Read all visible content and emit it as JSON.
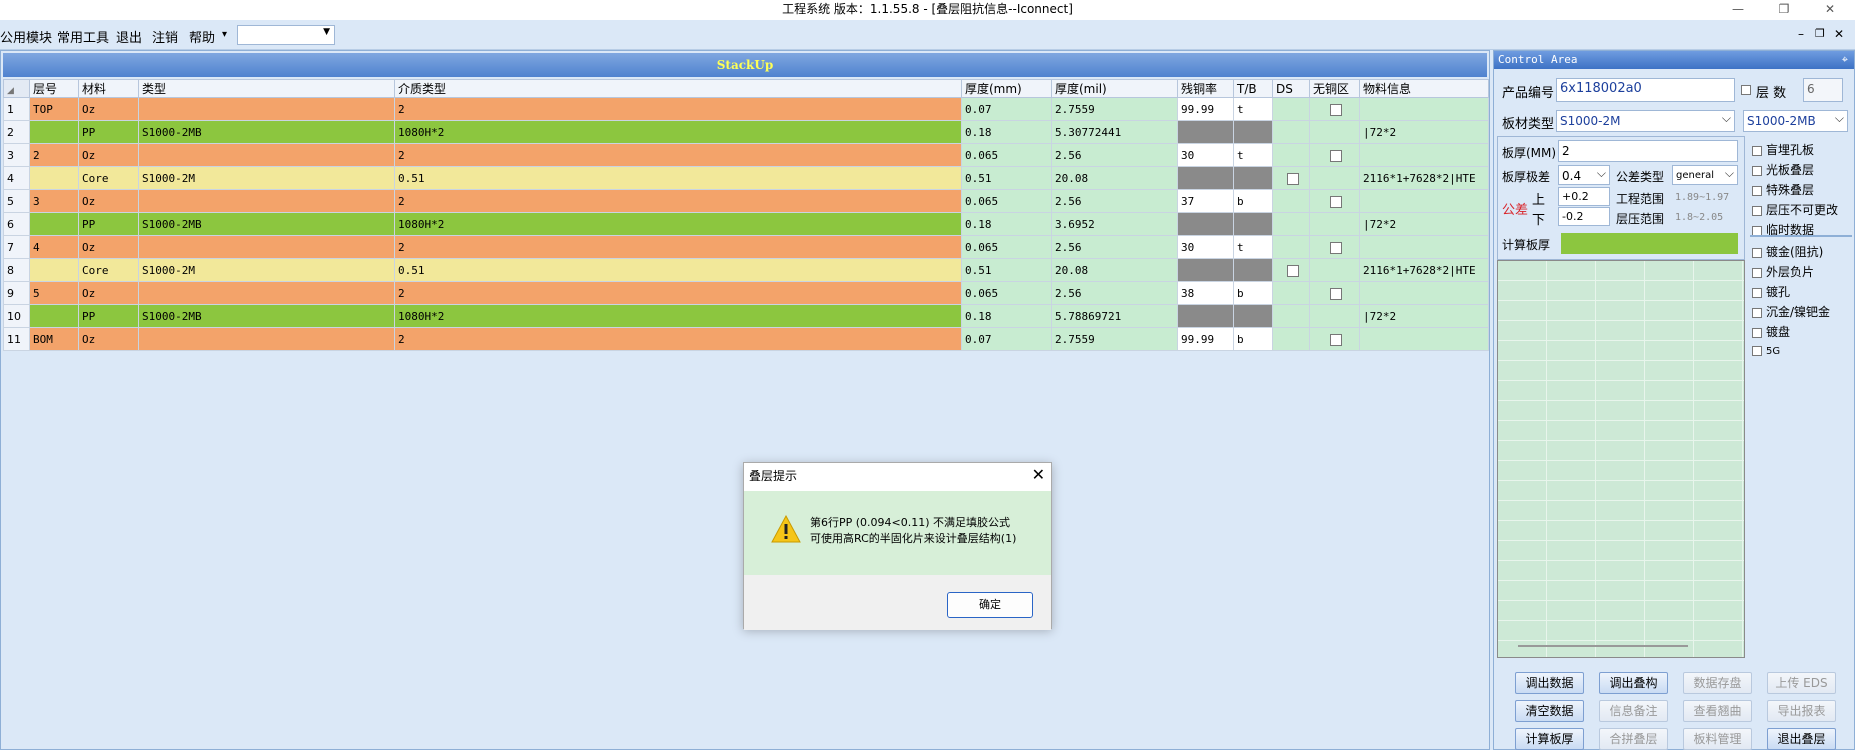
{
  "window": {
    "title": "工程系统   版本：1.1.55.8 - [叠层阻抗信息--Iconnect]",
    "minimize": "—",
    "restore": "❐",
    "close": "✕"
  },
  "menu": {
    "items": [
      "公用模块",
      "常用工具",
      "退出",
      "注销",
      "帮助"
    ],
    "help_arrow": "▾",
    "combo_value": "",
    "mdi_controls": [
      "–",
      "❐",
      "✕"
    ]
  },
  "stackup": {
    "title": "StackUp",
    "columns": [
      "层号",
      "材料",
      "类型",
      "介质类型",
      "厚度(mm)",
      "厚度(mil)",
      "残铜率",
      "T/B",
      "DS",
      "无铜区",
      "物料信息"
    ],
    "rows": [
      {
        "num": "1",
        "layer": "TOP",
        "material": "Oz",
        "type": "",
        "dielectric": "2",
        "mm": "0.07",
        "mil": "2.7559",
        "cu": "99.99",
        "tb": "t",
        "info": "",
        "kind": "copper"
      },
      {
        "num": "2",
        "layer": "",
        "material": "PP",
        "type": "S1000-2MB",
        "dielectric": "1080H*2",
        "mm": "0.18",
        "mil": "5.30772441",
        "cu": "",
        "tb": "",
        "info": "|72*2",
        "kind": "pp"
      },
      {
        "num": "3",
        "layer": "2",
        "material": "Oz",
        "type": "",
        "dielectric": "2",
        "mm": "0.065",
        "mil": "2.56",
        "cu": "30",
        "tb": "t",
        "info": "",
        "kind": "copper"
      },
      {
        "num": "4",
        "layer": "",
        "material": "Core",
        "type": "S1000-2M",
        "dielectric": "0.51",
        "mm": "0.51",
        "mil": "20.08",
        "cu": "",
        "tb": "",
        "info": "2116*1+7628*2|HTE",
        "kind": "core"
      },
      {
        "num": "5",
        "layer": "3",
        "material": "Oz",
        "type": "",
        "dielectric": "2",
        "mm": "0.065",
        "mil": "2.56",
        "cu": "37",
        "tb": "b",
        "info": "",
        "kind": "copper"
      },
      {
        "num": "6",
        "layer": "",
        "material": "PP",
        "type": "S1000-2MB",
        "dielectric": "1080H*2",
        "mm": "0.18",
        "mil": "3.6952",
        "cu": "",
        "tb": "",
        "info": "|72*2",
        "kind": "pp"
      },
      {
        "num": "7",
        "layer": "4",
        "material": "Oz",
        "type": "",
        "dielectric": "2",
        "mm": "0.065",
        "mil": "2.56",
        "cu": "30",
        "tb": "t",
        "info": "",
        "kind": "copper"
      },
      {
        "num": "8",
        "layer": "",
        "material": "Core",
        "type": "S1000-2M",
        "dielectric": "0.51",
        "mm": "0.51",
        "mil": "20.08",
        "cu": "",
        "tb": "",
        "info": "2116*1+7628*2|HTE",
        "kind": "core"
      },
      {
        "num": "9",
        "layer": "5",
        "material": "Oz",
        "type": "",
        "dielectric": "2",
        "mm": "0.065",
        "mil": "2.56",
        "cu": "38",
        "tb": "b",
        "info": "",
        "kind": "copper"
      },
      {
        "num": "10",
        "layer": "",
        "material": "PP",
        "type": "S1000-2MB",
        "dielectric": "1080H*2",
        "mm": "0.18",
        "mil": "5.78869721",
        "cu": "",
        "tb": "",
        "info": "|72*2",
        "kind": "pp"
      },
      {
        "num": "11",
        "layer": "BOM",
        "material": "Oz",
        "type": "",
        "dielectric": "2",
        "mm": "0.07",
        "mil": "2.7559",
        "cu": "99.99",
        "tb": "b",
        "info": "",
        "kind": "copper"
      }
    ]
  },
  "dialog": {
    "title": "叠层提示",
    "line1": "第6行PP (0.094<0.11) 不满足填胶公式",
    "line2": "可使用高RC的半固化片来设计叠层结构(1)",
    "ok": "确定",
    "close": "✕"
  },
  "control": {
    "title": "Control Area",
    "pin": "⌖",
    "product_label": "产品编号",
    "product_value": "6x118002a0",
    "layers_label": "层 数",
    "layers_value": "6",
    "board_type_label": "板材类型",
    "board_type_value": "S1000-2M",
    "board_type_value2": "S1000-2MB",
    "thickness_label": "板厚(MM)",
    "thickness_value": "2",
    "tol_label": "板厚极差",
    "tol_value": "0.4",
    "tol_type_label": "公差类型",
    "tol_type_value": "general",
    "gongcha_label": "公差",
    "upper_label": "上",
    "lower_label": "下",
    "upper_value": "+0.2",
    "lower_value": "-0.2",
    "eng_range_label": "工程范围",
    "eng_range_value": "1.89~1.97",
    "press_range_label": "层压范围",
    "press_range_value": "1.8~2.05",
    "calc_label": "计算板厚",
    "options": [
      "盲埋孔板",
      "光板叠层",
      "特殊叠层",
      "层压不可更改",
      "临时数据",
      "镀金(阻抗)",
      "外层负片",
      "镀孔",
      "沉金/镍钯金",
      "镀盘",
      "5G"
    ],
    "buttons": [
      {
        "label": "调出数据",
        "enabled": true
      },
      {
        "label": "调出叠构",
        "enabled": true
      },
      {
        "label": "数据存盘",
        "enabled": false
      },
      {
        "label": "上传 EDS",
        "enabled": false
      },
      {
        "label": "清空数据",
        "enabled": true
      },
      {
        "label": "信息备注",
        "enabled": false
      },
      {
        "label": "查看翘曲",
        "enabled": false
      },
      {
        "label": "导出报表",
        "enabled": false
      },
      {
        "label": "计算板厚",
        "enabled": true
      },
      {
        "label": "合拼叠层",
        "enabled": false
      },
      {
        "label": "板料管理",
        "enabled": false
      },
      {
        "label": "退出叠层",
        "enabled": true
      }
    ]
  },
  "colors": {
    "copper": "#f3a36a",
    "pp": "#8cc63f",
    "core": "#f2e89a",
    "cell_light": "#c8ecd1"
  }
}
